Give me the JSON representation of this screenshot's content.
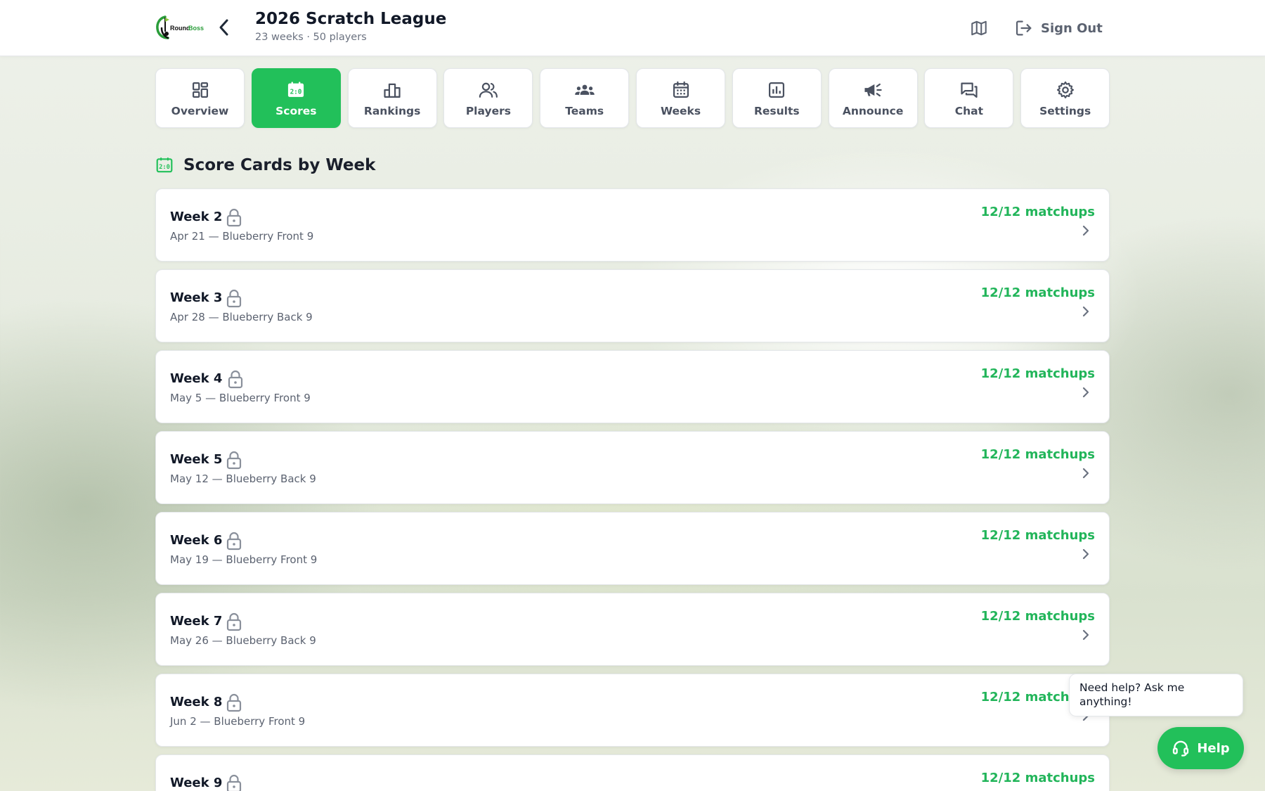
{
  "header": {
    "logo_text": "RoundBoss",
    "title": "2026 Scratch League",
    "subtitle": "23 weeks · 50 players",
    "signout_label": "Sign Out"
  },
  "colors": {
    "accent": "#22c05a",
    "matchups_text": "#22b55a",
    "muted_text": "#5b6270"
  },
  "tabs": [
    {
      "label": "Overview",
      "icon": "dashboard-icon",
      "active": false
    },
    {
      "label": "Scores",
      "icon": "scoreboard-icon",
      "active": true
    },
    {
      "label": "Rankings",
      "icon": "podium-icon",
      "active": false
    },
    {
      "label": "Players",
      "icon": "users-icon",
      "active": false
    },
    {
      "label": "Teams",
      "icon": "groups-icon",
      "active": false
    },
    {
      "label": "Weeks",
      "icon": "calendar-icon",
      "active": false
    },
    {
      "label": "Results",
      "icon": "bar-chart-icon",
      "active": false
    },
    {
      "label": "Announce",
      "icon": "megaphone-icon",
      "active": false
    },
    {
      "label": "Chat",
      "icon": "chat-icon",
      "active": false
    },
    {
      "label": "Settings",
      "icon": "gear-icon",
      "active": false
    }
  ],
  "section": {
    "title": "Score Cards by Week",
    "icon": "scoreboard-icon"
  },
  "weeks": [
    {
      "name": "Week 2",
      "date": "Apr 21 — Blueberry Front 9",
      "matchups": "12/12 matchups",
      "locked": true
    },
    {
      "name": "Week 3",
      "date": "Apr 28 — Blueberry Back 9",
      "matchups": "12/12 matchups",
      "locked": true
    },
    {
      "name": "Week 4",
      "date": "May 5 — Blueberry Front 9",
      "matchups": "12/12 matchups",
      "locked": true
    },
    {
      "name": "Week 5",
      "date": "May 12 — Blueberry Back 9",
      "matchups": "12/12 matchups",
      "locked": true
    },
    {
      "name": "Week 6",
      "date": "May 19 — Blueberry Front 9",
      "matchups": "12/12 matchups",
      "locked": true
    },
    {
      "name": "Week 7",
      "date": "May 26 — Blueberry Back 9",
      "matchups": "12/12 matchups",
      "locked": true
    },
    {
      "name": "Week 8",
      "date": "Jun 2 — Blueberry Front 9",
      "matchups": "12/12 matchups",
      "locked": true
    },
    {
      "name": "Week 9",
      "date": "",
      "matchups": "12/12 matchups",
      "locked": true
    }
  ],
  "help": {
    "bubble_text": "Need help? Ask me anything!",
    "button_label": "Help"
  }
}
